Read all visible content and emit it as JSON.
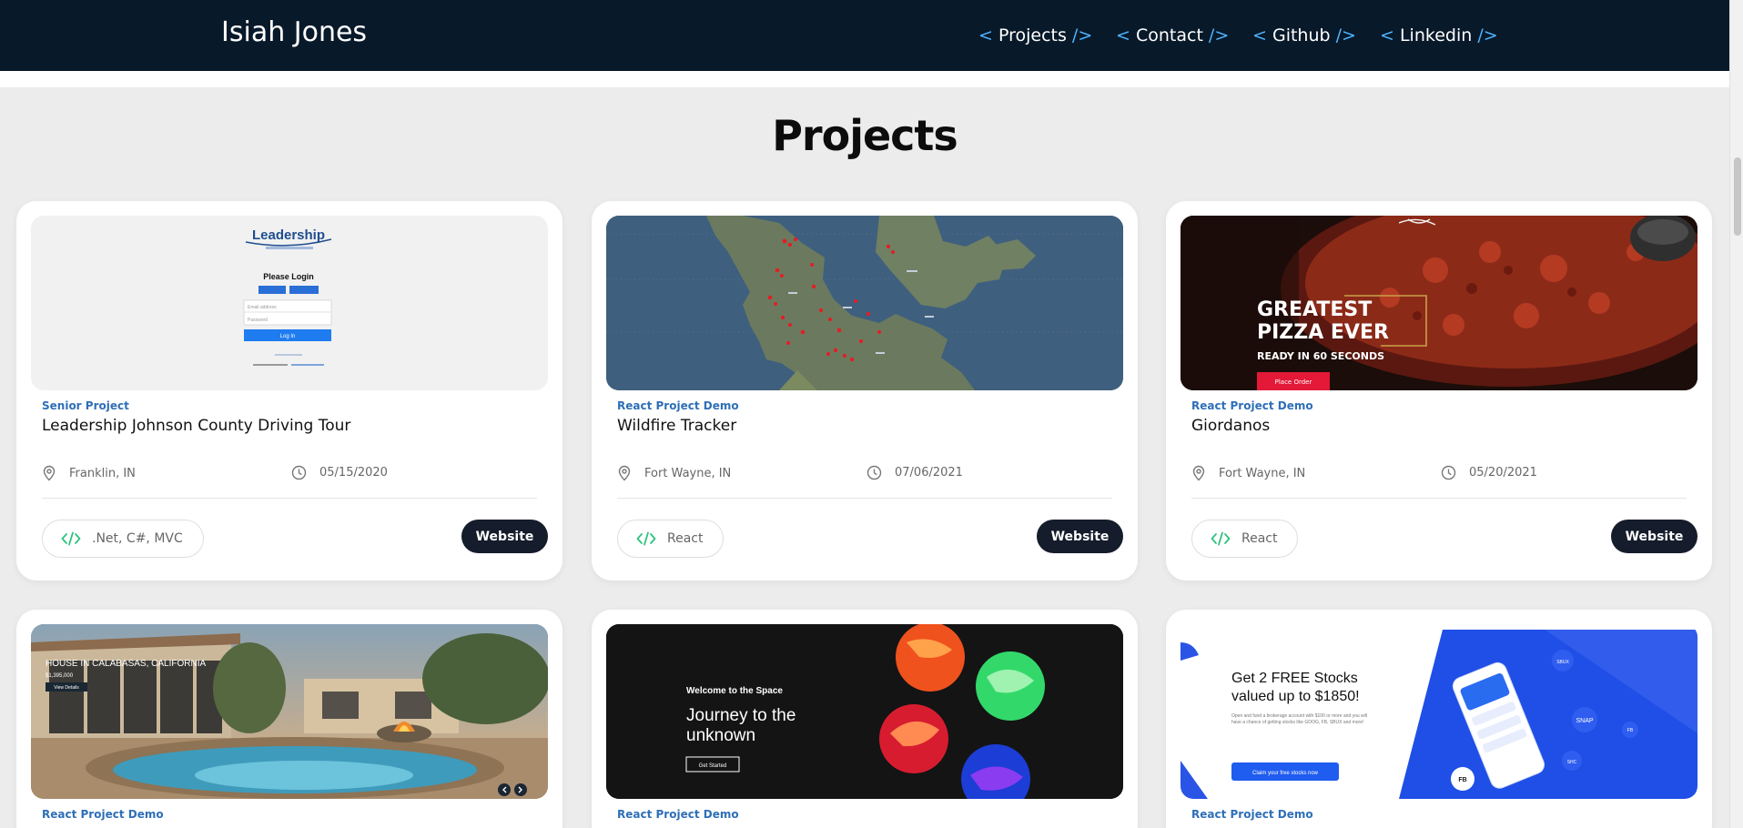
{
  "nav": {
    "brand": "Isiah Jones",
    "links": [
      {
        "open": "< ",
        "label": "Projects",
        "close": " />"
      },
      {
        "open": "< ",
        "label": "Contact",
        "close": " />"
      },
      {
        "open": "< ",
        "label": "Github",
        "close": " />"
      },
      {
        "open": "< ",
        "label": "Linkedin",
        "close": " />"
      }
    ]
  },
  "section_title": "Projects",
  "cards": [
    {
      "tag": "Senior Project",
      "title": "Leadership Johnson County Driving Tour",
      "location": "Franklin, IN",
      "date": "05/15/2020",
      "tech": ".Net, C#, MVC",
      "button": "Website",
      "thumb": {
        "logo": "Leadership",
        "heading": "Please Login",
        "email_placeholder": "Email address",
        "password_placeholder": "Password",
        "login": "Log In"
      }
    },
    {
      "tag": "React Project Demo",
      "title": "Wildfire Tracker",
      "location": "Fort Wayne, IN",
      "date": "07/06/2021",
      "tech": "React",
      "button": "Website"
    },
    {
      "tag": "React Project Demo",
      "title": "Giordanos",
      "location": "Fort Wayne, IN",
      "date": "05/20/2021",
      "tech": "React",
      "button": "Website",
      "thumb": {
        "line1": "GREATEST",
        "line2": "PIZZA EVER",
        "line3": "READY IN 60 SECONDS",
        "cta": "Place Order"
      }
    },
    {
      "tag": "React Project Demo",
      "thumb": {
        "caption": "HOUSE IN CALABASAS, CALIFORNIA",
        "price": "$1,395,000",
        "cta": "View Details"
      }
    },
    {
      "tag": "React Project Demo",
      "thumb": {
        "kicker": "Welcome to the Space",
        "headline1": "Journey to the",
        "headline2": "unknown",
        "cta": "Get Started"
      }
    },
    {
      "tag": "React Project Demo",
      "thumb": {
        "headline1": "Get 2 FREE Stocks",
        "headline2": "valued up to $1850!",
        "body": "Open and fund a brokerage account with $100 or more and you will have a chance of getting stocks like GOOG, FB, SBUX and more!",
        "cta": "Claim your free stocks now",
        "bubbles": [
          "SBUX",
          "SNAP",
          "FB",
          "FB",
          "SHC"
        ]
      }
    }
  ],
  "colors": {
    "nav_bg": "#08192a",
    "nav_tag": "#4fb3ff",
    "tag_label": "#2e6fb7",
    "button_bg": "#151c2b",
    "code_icon": "#2ec27e"
  },
  "icons": {
    "location": "map-pin-icon",
    "date": "clock-icon",
    "tech": "code-icon"
  }
}
